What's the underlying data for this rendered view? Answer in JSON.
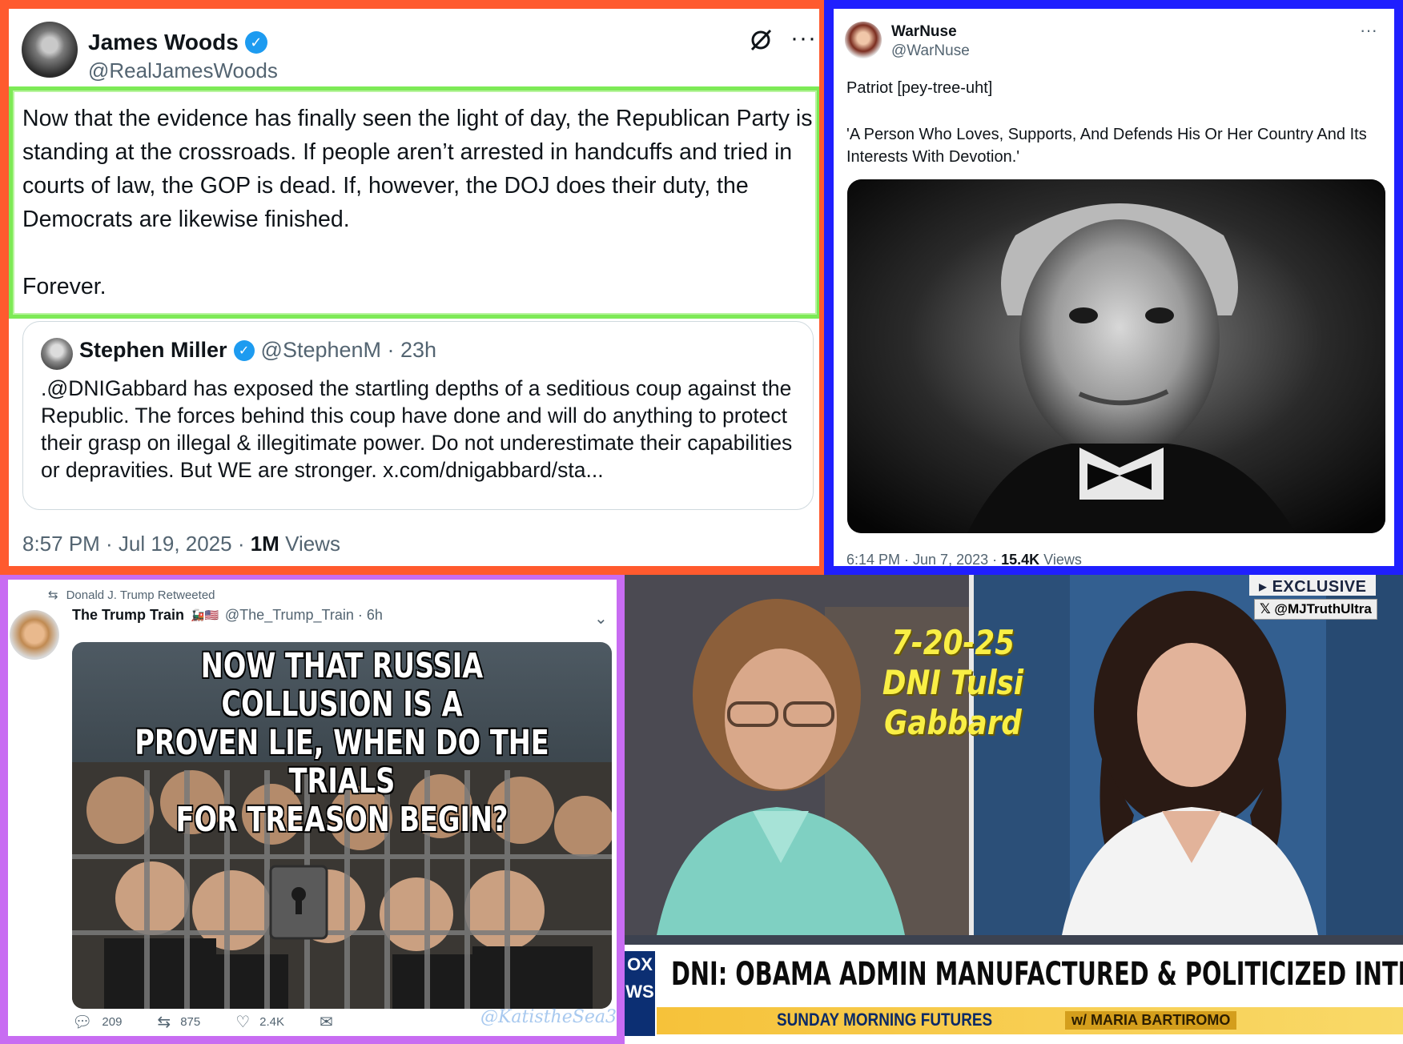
{
  "james_woods_tweet": {
    "name": "James Woods",
    "handle": "@RealJamesWoods",
    "body": "Now that the evidence has finally seen the light of day, the Republican Party is standing at the crossroads. If people aren’t arrested in handcuffs and tried in courts of law, the GOP is dead. If, however, the DOJ does their duty, the Democrats are likewise finished.\n\nForever.",
    "quote": {
      "name": "Stephen Miller",
      "handle_time": "@StephenM · 23h",
      "body": ".@DNIGabbard has exposed the startling depths of a seditious coup against the Republic. The forces behind this coup have done and will do anything to protect their grasp on illegal & illegitimate power. Do not underestimate their capabilities or depravities. But WE are stronger. x.com/dnigabbard/sta..."
    },
    "time_date": "8:57 PM · Jul 19, 2025 · ",
    "views_count": "1M",
    "views_label": " Views"
  },
  "warnuse_tweet": {
    "name": "WarNuse",
    "handle": "@WarNuse",
    "line1": "Patriot [pey-tree-uht]",
    "line2": "'A Person Who Loves, Supports, And Defends His Or Her Country And Its Interests With Devotion.'",
    "time_date": "6:14 PM · Jun 7, 2023 · ",
    "views_count": "15.4K",
    "views_label": " Views"
  },
  "trump_train_tweet": {
    "retweeted_by": "Donald J. Trump Retweeted",
    "name": "The Trump Train",
    "handle_time": "@The_Trump_Train · 6h",
    "meme_text": "NOW THAT RUSSIA COLLUSION IS A\nPROVEN LIE, WHEN DO THE TRIALS\nFOR TREASON BEGIN?",
    "replies": "209",
    "retweets": "875",
    "likes": "2.4K",
    "watermark": "@KatistheSea3"
  },
  "tv_frame": {
    "exclusive": "▸ EXCLUSIVE",
    "x_tag": "@MJTruthUltra",
    "date": "7-20-25",
    "subject": "DNI Tulsi Gabbard",
    "network": "OX\nWS",
    "headline": "DNI: OBAMA ADMIN MANUFACTURED & POLITICIZED INTEL",
    "show": "SUNDAY MORNING FUTURES",
    "host": "w/ MARIA BARTIROMO"
  },
  "colors": {
    "panel1_border": "#ff5a2e",
    "panel2_border": "#1f1fff",
    "panel3_border": "#c86cf2",
    "highlight": "#7dea56",
    "verified": "#1d9bf0"
  }
}
